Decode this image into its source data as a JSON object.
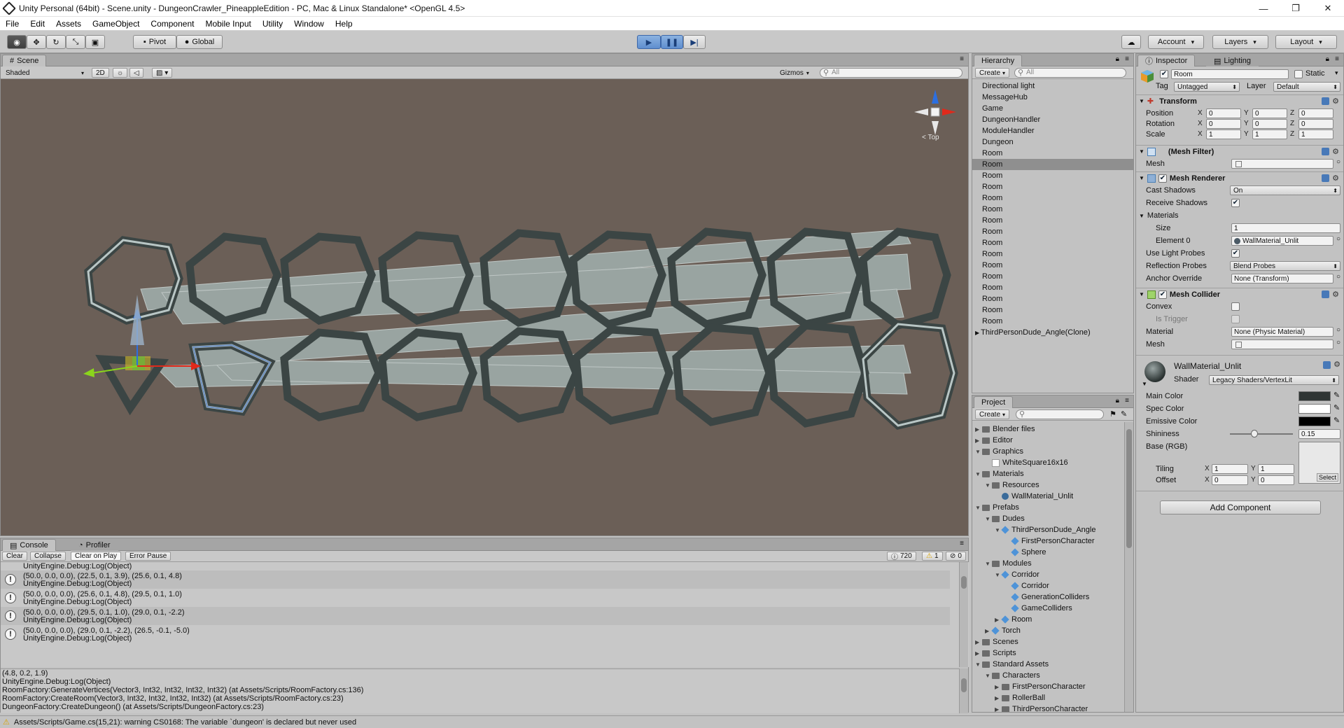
{
  "window": {
    "title": "Unity Personal (64bit) - Scene.unity - DungeonCrawler_PineappleEdition - PC, Mac & Linux Standalone* <OpenGL 4.5>",
    "minimize": "—",
    "maximize": "❐",
    "close": "✕"
  },
  "menu": [
    "File",
    "Edit",
    "Assets",
    "GameObject",
    "Component",
    "Mobile Input",
    "Utility",
    "Window",
    "Help"
  ],
  "toolbar": {
    "pivot": "Pivot",
    "global": "Global",
    "account": "Account",
    "layers": "Layers",
    "layout": "Layout"
  },
  "scene": {
    "tab": "Scene",
    "shading": "Shaded",
    "mode2d": "2D",
    "gizmos": "Gizmos",
    "search_placeholder": "All",
    "gizmo_label": "Top"
  },
  "hierarchy": {
    "tab": "Hierarchy",
    "create": "Create",
    "search_placeholder": "All",
    "items": [
      "Directional light",
      "MessageHub",
      "Game",
      "DungeonHandler",
      "ModuleHandler",
      "Dungeon",
      "Room",
      "Room",
      "Room",
      "Room",
      "Room",
      "Room",
      "Room",
      "Room",
      "Room",
      "Room",
      "Room",
      "Room",
      "Room",
      "Room",
      "Room",
      "Room",
      "ThirdPersonDude_Angle(Clone)"
    ],
    "selected_index": 7
  },
  "project": {
    "tab": "Project",
    "create": "Create",
    "items": [
      {
        "label": "Blender files",
        "depth": 0,
        "kind": "folder",
        "arrow": "▶"
      },
      {
        "label": "Editor",
        "depth": 0,
        "kind": "folder",
        "arrow": "▶"
      },
      {
        "label": "Graphics",
        "depth": 0,
        "kind": "folder",
        "arrow": "▼"
      },
      {
        "label": "WhiteSquare16x16",
        "depth": 1,
        "kind": "image",
        "arrow": ""
      },
      {
        "label": "Materials",
        "depth": 0,
        "kind": "folder",
        "arrow": "▼"
      },
      {
        "label": "Resources",
        "depth": 1,
        "kind": "folder",
        "arrow": "▼"
      },
      {
        "label": "WallMaterial_Unlit",
        "depth": 2,
        "kind": "material",
        "arrow": ""
      },
      {
        "label": "Prefabs",
        "depth": 0,
        "kind": "folder",
        "arrow": "▼"
      },
      {
        "label": "Dudes",
        "depth": 1,
        "kind": "folder",
        "arrow": "▼"
      },
      {
        "label": "ThirdPersonDude_Angle",
        "depth": 2,
        "kind": "prefab",
        "arrow": "▼"
      },
      {
        "label": "FirstPersonCharacter",
        "depth": 3,
        "kind": "prefab",
        "arrow": ""
      },
      {
        "label": "Sphere",
        "depth": 3,
        "kind": "prefab",
        "arrow": ""
      },
      {
        "label": "Modules",
        "depth": 1,
        "kind": "folder",
        "arrow": "▼"
      },
      {
        "label": "Corridor",
        "depth": 2,
        "kind": "prefab",
        "arrow": "▼"
      },
      {
        "label": "Corridor",
        "depth": 3,
        "kind": "prefab",
        "arrow": ""
      },
      {
        "label": "GenerationColliders",
        "depth": 3,
        "kind": "prefab",
        "arrow": ""
      },
      {
        "label": "GameColliders",
        "depth": 3,
        "kind": "prefab",
        "arrow": ""
      },
      {
        "label": "Room",
        "depth": 2,
        "kind": "prefab",
        "arrow": "▶"
      },
      {
        "label": "Torch",
        "depth": 1,
        "kind": "prefab",
        "arrow": "▶"
      },
      {
        "label": "Scenes",
        "depth": 0,
        "kind": "folder",
        "arrow": "▶"
      },
      {
        "label": "Scripts",
        "depth": 0,
        "kind": "folder",
        "arrow": "▶"
      },
      {
        "label": "Standard Assets",
        "depth": 0,
        "kind": "folder",
        "arrow": "▼"
      },
      {
        "label": "Characters",
        "depth": 1,
        "kind": "folder",
        "arrow": "▼"
      },
      {
        "label": "FirstPersonCharacter",
        "depth": 2,
        "kind": "folder",
        "arrow": "▶"
      },
      {
        "label": "RollerBall",
        "depth": 2,
        "kind": "folder",
        "arrow": "▶"
      },
      {
        "label": "ThirdPersonCharacter",
        "depth": 2,
        "kind": "folder",
        "arrow": "▶"
      }
    ]
  },
  "inspector": {
    "tab": "Inspector",
    "tab2": "Lighting",
    "object_name": "Room",
    "static_label": "Static",
    "tag_label": "Tag",
    "tag_value": "Untagged",
    "layer_label": "Layer",
    "layer_value": "Default",
    "transform": {
      "title": "Transform",
      "rows": [
        {
          "label": "Position",
          "x": "0",
          "y": "0",
          "z": "0"
        },
        {
          "label": "Rotation",
          "x": "0",
          "y": "0",
          "z": "0"
        },
        {
          "label": "Scale",
          "x": "1",
          "y": "1",
          "z": "1"
        }
      ]
    },
    "axes": {
      "x": "X",
      "y": "Y",
      "z": "Z"
    },
    "mesh_filter": {
      "title": "(Mesh Filter)",
      "mesh_label": "Mesh"
    },
    "mesh_renderer": {
      "title": "Mesh Renderer",
      "cast_shadows_label": "Cast Shadows",
      "cast_shadows_value": "On",
      "receive_shadows_label": "Receive Shadows",
      "materials_label": "Materials",
      "size_label": "Size",
      "size_value": "1",
      "element0_label": "Element 0",
      "element0_value": "WallMaterial_Unlit",
      "light_probes_label": "Use Light Probes",
      "reflection_probes_label": "Reflection Probes",
      "reflection_probes_value": "Blend Probes",
      "anchor_override_label": "Anchor Override",
      "anchor_override_value": "None (Transform)"
    },
    "mesh_collider": {
      "title": "Mesh Collider",
      "convex_label": "Convex",
      "is_trigger_label": "Is Trigger",
      "material_label": "Material",
      "material_value": "None (Physic Material)",
      "mesh_label": "Mesh"
    },
    "material": {
      "name": "WallMaterial_Unlit",
      "shader_label": "Shader",
      "shader_value": "Legacy Shaders/VertexLit",
      "main_color_label": "Main Color",
      "spec_color_label": "Spec Color",
      "emissive_label": "Emissive Color",
      "shininess_label": "Shininess",
      "shininess_value": "0.15",
      "shininess_fraction": 0.15,
      "base_label": "Base (RGB)",
      "tiling_label": "Tiling",
      "tiling_x": "1",
      "tiling_y": "1",
      "offset_label": "Offset",
      "offset_x": "0",
      "offset_y": "0",
      "select_label": "Select",
      "main_color": "#2f3534",
      "spec_color": "#ffffff",
      "emissive_color": "#000000"
    },
    "add_component": "Add Component"
  },
  "console": {
    "tab": "Console",
    "tab2": "Profiler",
    "clear": "Clear",
    "collapse": "Collapse",
    "clear_on_play": "Clear on Play",
    "error_pause": "Error Pause",
    "count_log": "720",
    "count_warn": "1",
    "count_err": "0",
    "top_line": "UnityEngine.Debug:Log(Object)",
    "rows": [
      {
        "l1": "(50.0, 0.0, 0.0), (22.5, 0.1, 3.9), (25.6, 0.1, 4.8)",
        "l2": "UnityEngine.Debug:Log(Object)"
      },
      {
        "l1": "(50.0, 0.0, 0.0), (25.6, 0.1, 4.8), (29.5, 0.1, 1.0)",
        "l2": "UnityEngine.Debug:Log(Object)"
      },
      {
        "l1": "(50.0, 0.0, 0.0), (29.5, 0.1, 1.0), (29.0, 0.1, -2.2)",
        "l2": "UnityEngine.Debug:Log(Object)"
      },
      {
        "l1": "(50.0, 0.0, 0.0), (29.0, 0.1, -2.2), (26.5, -0.1, -5.0)",
        "l2": "UnityEngine.Debug:Log(Object)"
      }
    ],
    "detail": [
      "(4.8, 0.2, 1.9)",
      "UnityEngine.Debug:Log(Object)",
      "RoomFactory:GenerateVertices(Vector3, Int32, Int32, Int32, Int32) (at Assets/Scripts/RoomFactory.cs:136)",
      "RoomFactory:CreateRoom(Vector3, Int32, Int32, Int32, Int32) (at Assets/Scripts/RoomFactory.cs:23)",
      "DungeonFactory:CreateDungeon() (at Assets/Scripts/DungeonFactory.cs:23)"
    ]
  },
  "status": {
    "message": "Assets/Scripts/Game.cs(15,21): warning CS0168: The variable `dungeon' is declared but never used"
  },
  "colors": {
    "scene_bg": "#6b5f57",
    "panel": "#c2c2c2",
    "selection": "#8f8f8f",
    "room_fill": "#a9b6b4",
    "room_dark": "#3a4443",
    "axis_x": "#e0291b",
    "axis_y": "#8bd41c",
    "axis_z": "#2c6fe0"
  }
}
